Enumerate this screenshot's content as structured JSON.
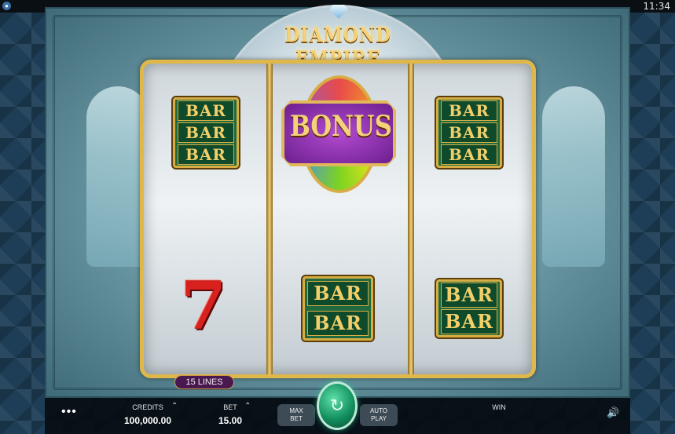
{
  "system": {
    "clock": "11:34"
  },
  "game": {
    "title": "DIAMOND EMPIRE"
  },
  "reels": {
    "reel1": {
      "top": [
        "BAR",
        "BAR",
        "BAR"
      ],
      "bottom": "7"
    },
    "reel2": {
      "top": "BONUS",
      "bottom": [
        "BAR",
        "BAR"
      ]
    },
    "reel3": {
      "top": [
        "BAR",
        "BAR",
        "BAR"
      ],
      "bottom": [
        "BAR",
        "BAR"
      ]
    }
  },
  "lines_badge": "15 LINES",
  "controls": {
    "menu": "•••",
    "credits_label": "CREDITS",
    "credits_value": "100,000.00",
    "bet_label": "BET",
    "bet_value": "15.00",
    "max_bet_line1": "MAX",
    "max_bet_line2": "BET",
    "auto_play_line1": "AUTO",
    "auto_play_line2": "PLAY",
    "win_label": "WIN",
    "up_arrow": "⌃",
    "sound_icon": "🔊"
  },
  "colors": {
    "reel_gold": "#e0b84a",
    "bar_green": "#1f6b3f",
    "bonus_purple": "#6c1f8f",
    "spin_green": "#13905f"
  }
}
